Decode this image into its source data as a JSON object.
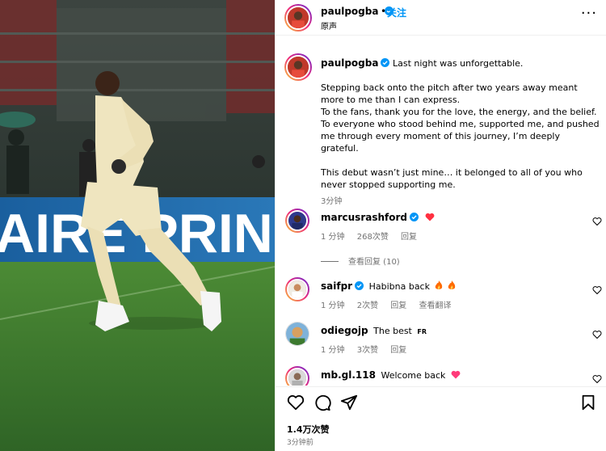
{
  "header": {
    "username": "paulpogba",
    "separator": "•",
    "follow_label": "关注",
    "audio_label": "原声",
    "more_label": "···"
  },
  "caption": {
    "username": "paulpogba",
    "lines": [
      "Last night was unforgettable.",
      "",
      "Stepping back onto the pitch after two years away meant more to me than I can express.",
      "To the fans, thank you for the love, the energy, and the belief. To everyone who stood behind me, supported me, and pushed me through every moment of this journey, I’m deeply grateful.",
      "",
      "This debut wasn’t just mine… it belonged to all of you who never stopped supporting me."
    ],
    "time": "3分钟"
  },
  "comments": [
    {
      "username": "marcusrashford",
      "text": "",
      "emoji": "heart",
      "time": "1 分钟",
      "likes": "268次赞",
      "reply": "回复",
      "translate": ""
    },
    {
      "username": "saifpr",
      "text": "Habibna back",
      "emoji": "fire",
      "time": "1 分钟",
      "likes": "2次赞",
      "reply": "回复",
      "translate": "查看翻译"
    },
    {
      "username": "odiegojp",
      "text": "The best",
      "emoji": "FR",
      "time": "1 分钟",
      "likes": "3次赞",
      "reply": "回复",
      "translate": ""
    },
    {
      "username": "mb.gl.118",
      "text": "Welcome back",
      "emoji": "heart",
      "time": "",
      "likes": "",
      "reply": "",
      "translate": ""
    }
  ],
  "view_replies": "查看回复 (10)",
  "post": {
    "likes": "1.4万次赞",
    "time": "3分钟前"
  },
  "media": {
    "banner_text": "AIRE  PRIN"
  },
  "colors": {
    "link_blue": "#0095f6",
    "verified_blue": "#0095f6",
    "heart_red": "#ff3040",
    "muted_text": "#737373"
  }
}
